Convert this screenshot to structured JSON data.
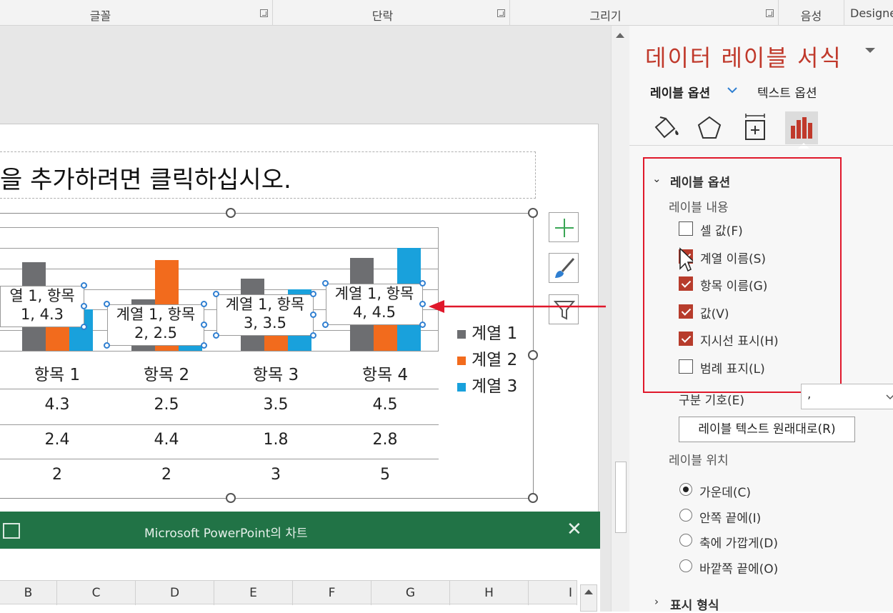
{
  "ribbon": {
    "groups": [
      {
        "label": "글꼴"
      },
      {
        "label": "단락"
      },
      {
        "label": "그리기"
      },
      {
        "label": "음성"
      },
      {
        "label": "Designe"
      }
    ]
  },
  "slide": {
    "title_placeholder": "을 추가하려면 클릭하십시오."
  },
  "chart_data": {
    "type": "bar",
    "categories": [
      "항목 1",
      "항목 2",
      "항목 3",
      "항목 4"
    ],
    "series": [
      {
        "name": "계열 1",
        "values": [
          4.3,
          2.5,
          3.5,
          4.5
        ],
        "color": "#6d6e71"
      },
      {
        "name": "계열 2",
        "values": [
          2.4,
          4.4,
          1.8,
          2.8
        ],
        "color": "#f26b1d"
      },
      {
        "name": "계열 3",
        "values": [
          2,
          2,
          3,
          5
        ],
        "color": "#19a1dc"
      }
    ],
    "data_labels": [
      {
        "line1": "열 1, 항목",
        "line2": "1, 4.3"
      },
      {
        "line1": "계열 1, 항목",
        "line2": "2, 2.5"
      },
      {
        "line1": "계열 1, 항목",
        "line2": "3, 3.5"
      },
      {
        "line1": "계열 1, 항목",
        "line2": "4, 4.5"
      }
    ],
    "legend_position": "right",
    "data_table": true
  },
  "excel": {
    "title": "Microsoft PowerPoint의 차트",
    "columns": [
      "B",
      "C",
      "D",
      "E",
      "F",
      "G",
      "H",
      "I"
    ]
  },
  "pane": {
    "title": "데이터 레이블 서식",
    "tab_label_options": "레이블 옵션",
    "tab_text_options": "텍스트 옵션",
    "section_label_options": "레이블 옵션",
    "label_contains": "레이블 내용",
    "checkboxes": [
      {
        "label": "셀 값(F)",
        "checked": false
      },
      {
        "label": "계열 이름(S)",
        "checked": true
      },
      {
        "label": "항목 이름(G)",
        "checked": true
      },
      {
        "label": "값(V)",
        "checked": true
      },
      {
        "label": "지시선 표시(H)",
        "checked": true
      },
      {
        "label": "범례 표지(L)",
        "checked": false
      }
    ],
    "separator_label": "구분 기호(E)",
    "separator_value": ",",
    "reset_button": "레이블 텍스트 원래대로(R)",
    "label_position": "레이블 위치",
    "radios": [
      {
        "label": "가운데(C)",
        "selected": true
      },
      {
        "label": "안쪽 끝에(I)",
        "selected": false
      },
      {
        "label": "축에 가깝게(D)",
        "selected": false
      },
      {
        "label": "바깥쪽 끝에(O)",
        "selected": false
      }
    ],
    "number_section": "표시 형식"
  }
}
